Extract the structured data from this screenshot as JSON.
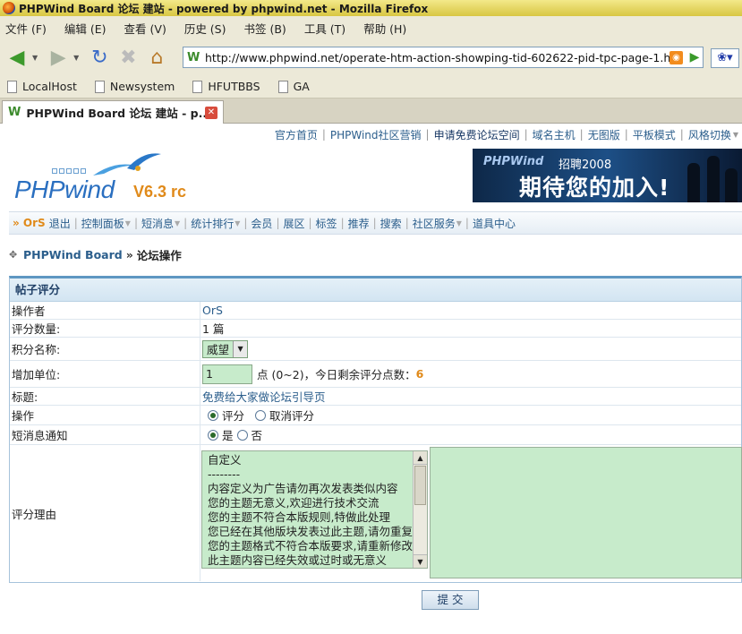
{
  "window": {
    "title": "PHPWind Board 论坛 建站 - powered by phpwind.net - Mozilla Firefox"
  },
  "menu": [
    "文件 (F)",
    "编辑 (E)",
    "查看 (V)",
    "历史 (S)",
    "书签 (B)",
    "工具 (T)",
    "帮助 (H)"
  ],
  "address": {
    "url": "http://www.phpwind.net/operate-htm-action-showping-tid-602622-pid-tpc-page-1.html"
  },
  "bookmarks": [
    "LocalHost",
    "Newsystem",
    "HFUTBBS",
    "GA"
  ],
  "tab": {
    "title": "PHPWind Board 论坛 建站 - p..."
  },
  "toplinks": {
    "home": "官方首页",
    "marketing": "PHPWind社区营销",
    "apply": "申请免费论坛空间",
    "domain": "域名主机",
    "noimg": "无图版",
    "flat": "平板模式",
    "style": "风格切换"
  },
  "logo": {
    "word": "PHPwind",
    "version": "V6.3 rc"
  },
  "banner": {
    "brand": "PHPWind",
    "sub": "招聘2008",
    "slogan": "期待您的加入!"
  },
  "nav": {
    "user": "» OrS",
    "logout": "退出",
    "items": [
      "控制面板",
      "短消息",
      "统计排行",
      "会员",
      "展区",
      "标签",
      "推荐",
      "搜索",
      "社区服务",
      "道具中心"
    ]
  },
  "breadcrumb": {
    "board": "PHPWind Board",
    "sep": "»",
    "current": "论坛操作"
  },
  "form": {
    "heading": "帖子评分",
    "operator_label": "操作者",
    "operator_value": "OrS",
    "count_label": "评分数量:",
    "count_value": "1 篇",
    "credit_label": "积分名称:",
    "credit_value": "威望",
    "unit_label": "增加单位:",
    "unit_value": "1",
    "unit_hint": "点 (0~2)，今日剩余评分点数：",
    "unit_remaining": "6",
    "title_label": "标题:",
    "title_value": "免费给大家做论坛引导页",
    "action_label": "操作",
    "action_rate": "评分",
    "action_cancel": "取消评分",
    "notify_label": "短消息通知",
    "notify_yes": "是",
    "notify_no": "否",
    "reason_label": "评分理由",
    "reasons": [
      "自定义",
      "--------",
      "内容定义为广告请勿再次发表类似内容",
      "您的主题无意义,欢迎进行技术交流",
      "您的主题不符合本版规则,特做此处理",
      "您已经在其他版块发表过此主题,请勿重复",
      "您的主题格式不符合本版要求,请重新修改",
      "此主题内容已经失效或过时或无意义"
    ],
    "submit": "提 交"
  }
}
